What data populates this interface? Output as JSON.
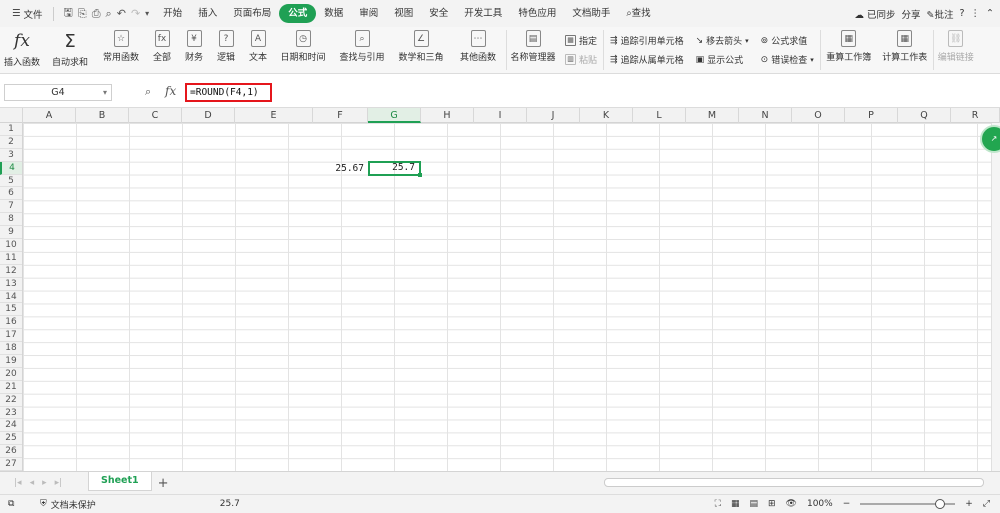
{
  "menubar": {
    "file_label": "文件",
    "tabs": [
      {
        "label": "开始",
        "active": false
      },
      {
        "label": "插入",
        "active": false
      },
      {
        "label": "页面布局",
        "active": false
      },
      {
        "label": "公式",
        "active": true
      },
      {
        "label": "数据",
        "active": false
      },
      {
        "label": "审阅",
        "active": false
      },
      {
        "label": "视图",
        "active": false
      },
      {
        "label": "安全",
        "active": false
      },
      {
        "label": "开发工具",
        "active": false
      },
      {
        "label": "特色应用",
        "active": false
      },
      {
        "label": "文档助手",
        "active": false
      }
    ],
    "search_label": "查找",
    "sync_label": "已同步",
    "share_label": "分享",
    "comment_label": "批注",
    "help_label": "?"
  },
  "ribbon": {
    "insert_function": "插入函数",
    "autosum": "自动求和",
    "common_functions": "常用函数",
    "all": "全部",
    "finance": "财务",
    "logic": "逻辑",
    "text": "文本",
    "datetime": "日期和时间",
    "lookup": "查找与引用",
    "math": "数学和三角",
    "other": "其他函数",
    "name_manager": "名称管理器",
    "specify": "指定",
    "paste": "粘贴",
    "trace_precedents": "追踪引用单元格",
    "trace_dependents": "追踪从属单元格",
    "remove_arrows": "移去箭头",
    "show_formulas": "显示公式",
    "evaluate": "公式求值",
    "error_check": "错误检查",
    "recalc_workbook": "重算工作簿",
    "calc_sheet": "计算工作表",
    "edit_links": "编辑链接"
  },
  "formula_bar": {
    "name_box": "G4",
    "fx_label": "fx",
    "formula": "=ROUND(F4,1)"
  },
  "grid": {
    "columns": [
      "A",
      "B",
      "C",
      "D",
      "E",
      "F",
      "G",
      "H",
      "I",
      "J",
      "K",
      "L",
      "M",
      "N",
      "O",
      "P",
      "Q",
      "R"
    ],
    "selected_column": "G",
    "rows": [
      "1",
      "2",
      "3",
      "4",
      "5",
      "6",
      "7",
      "8",
      "9",
      "10",
      "11",
      "12",
      "13",
      "14",
      "15",
      "16",
      "17",
      "18",
      "19",
      "20",
      "21",
      "22",
      "23",
      "24",
      "25",
      "26",
      "27"
    ],
    "selected_row": "4",
    "cells": {
      "F4": "25.67",
      "G4": "25.7"
    }
  },
  "sheets": {
    "tabs": [
      "Sheet1"
    ],
    "add_label": "+"
  },
  "status": {
    "protection": "文档未保护",
    "sum_value": "25.7",
    "zoom": "100%"
  },
  "colors": {
    "accent": "#1fa054",
    "formula_highlight": "#e5161c"
  }
}
